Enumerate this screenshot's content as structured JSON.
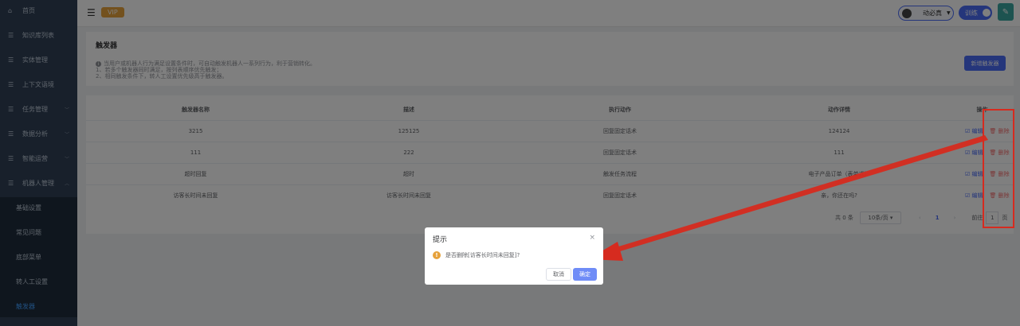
{
  "sidebar": {
    "items": [
      {
        "icon": "house-icon",
        "glyph": "⌂",
        "label": "首页"
      },
      {
        "icon": "list-icon",
        "glyph": "☰",
        "label": "知识库列表"
      },
      {
        "icon": "list-icon",
        "glyph": "☰",
        "label": "实体管理"
      },
      {
        "icon": "list-icon",
        "glyph": "☰",
        "label": "上下文语境"
      },
      {
        "icon": "list-icon",
        "glyph": "☰",
        "label": "任务管理",
        "chevron": "﹀"
      },
      {
        "icon": "list-icon",
        "glyph": "☰",
        "label": "数据分析",
        "chevron": "﹀"
      },
      {
        "icon": "list-icon",
        "glyph": "☰",
        "label": "智能运营",
        "chevron": "﹀"
      },
      {
        "icon": "list-icon",
        "glyph": "☰",
        "label": "机器人管理",
        "chevron": "︿"
      }
    ],
    "submenu": [
      "基础设置",
      "常见问题",
      "底部菜单",
      "转人工设置",
      "触发器"
    ]
  },
  "topbar": {
    "vip": "VIP",
    "user_name": "动必真",
    "user_caret": "▼",
    "train_label": "训练"
  },
  "header": {
    "title": "触发器",
    "desc_line1": "当用户或机器人行为满足设置条件时，可自动触发机器人一系列行为，利于营销转化。",
    "desc_line2": "1、若多个触发器同时满足，按列表顺序优先触发；",
    "desc_line3": "2、相同触发条件下，转人工设置优先级高于触发器。",
    "add_button": "新增触发器"
  },
  "table": {
    "headers": [
      "触发器名称",
      "描述",
      "执行动作",
      "动作详情",
      "操作"
    ],
    "rows": [
      [
        "3215",
        "125125",
        "回复固定话术",
        "124124"
      ],
      [
        "111",
        "222",
        "回复固定话术",
        "111"
      ],
      [
        "超时回复",
        "超时",
        "触发任务流程",
        "电子产品订单（表单式）"
      ],
      [
        "访客长时间未回复",
        "访客长时间未回复",
        "回复固定话术",
        "亲，你还在吗?"
      ]
    ],
    "edit_label": "☑ 编辑",
    "delete_label": "🗑 删除"
  },
  "pagination": {
    "total": "共 0 条",
    "page_size": "10条/页 ▾",
    "prev": "‹",
    "current": "1",
    "next": "›",
    "goto_prefix": "前往",
    "goto_value": "1",
    "goto_suffix": "页"
  },
  "dialog": {
    "title": "提示",
    "close": "×",
    "warn_glyph": "!",
    "message": "是否删除[访客长时间未回复]?",
    "cancel": "取消",
    "confirm": "确定"
  },
  "colors": {
    "sidebar_bg": "#304156",
    "accent": "#4a6cf7",
    "danger": "#f56c6c",
    "annotation_red": "#d62b1f"
  }
}
